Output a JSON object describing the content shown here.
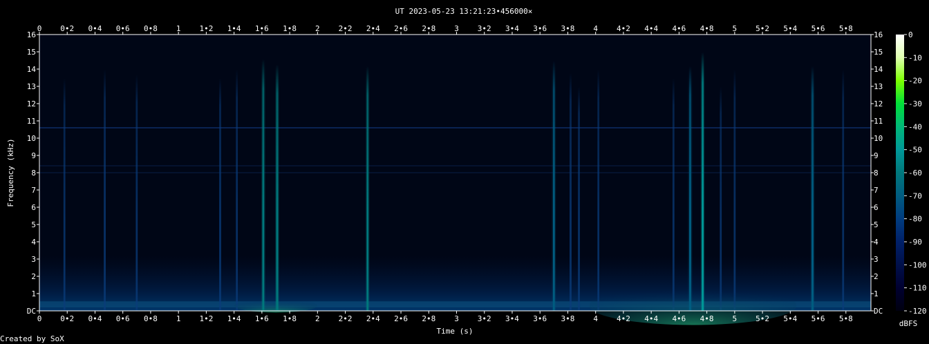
{
  "chart_data": {
    "type": "heatmap",
    "title": "UT 2023-05-23 13:21:23•456000×",
    "xlabel": "Time (s)",
    "ylabel": "Frequency (kHz)",
    "colorbar_label": "dBFS",
    "footer": "Created by SoX",
    "xlim": [
      0,
      5.98
    ],
    "ylim": [
      0,
      16
    ],
    "x_tick_values": [
      0,
      0.2,
      0.4,
      0.6,
      0.8,
      1,
      1.2,
      1.4,
      1.6,
      1.8,
      2,
      2.2,
      2.4,
      2.6,
      2.8,
      3,
      3.2,
      3.4,
      3.6,
      3.8,
      4,
      4.2,
      4.4,
      4.6,
      4.8,
      5,
      5.2,
      5.4,
      5.6,
      5.8
    ],
    "x_tick_labels": [
      "0",
      "0•2",
      "0•4",
      "0•6",
      "0•8",
      "1",
      "1•2",
      "1•4",
      "1•6",
      "1•8",
      "2",
      "2•2",
      "2•4",
      "2•6",
      "2•8",
      "3",
      "3•2",
      "3•4",
      "3•6",
      "3•8",
      "4",
      "4•2",
      "4•4",
      "4•6",
      "4•8",
      "5",
      "5•2",
      "5•4",
      "5•6",
      "5•8"
    ],
    "y_tick_values": [
      0,
      1,
      2,
      3,
      4,
      5,
      6,
      7,
      8,
      9,
      10,
      11,
      12,
      13,
      14,
      15,
      16
    ],
    "y_tick_labels": [
      "DC",
      "1",
      "2",
      "3",
      "4",
      "5",
      "6",
      "7",
      "8",
      "9",
      "10",
      "11",
      "12",
      "13",
      "14",
      "15",
      "16"
    ],
    "colorbar_ticks": [
      "0",
      "-10",
      "-20",
      "-30",
      "-40",
      "-50",
      "-60",
      "-70",
      "-80",
      "-90",
      "-100",
      "-110",
      "-120"
    ],
    "colorbar_range": [
      -120,
      0
    ],
    "colormap": [
      "#ffffff",
      "#e0ffb0",
      "#7cff00",
      "#00e038",
      "#00b878",
      "#009898",
      "#00787c",
      "#005c80",
      "#003c80",
      "#002068",
      "#00104a",
      "#000030",
      "#000010"
    ],
    "background_level_dbfs": -115,
    "low_band_noise_top_khz": 3.2,
    "horizontal_lines_khz": [
      10.6,
      8.4,
      8.0
    ],
    "strong_events": [
      {
        "t": 1.61,
        "top_khz": 14.6,
        "peak_dbfs": -55
      },
      {
        "t": 1.71,
        "top_khz": 14.3,
        "peak_dbfs": -60
      },
      {
        "t": 2.36,
        "top_khz": 14.2,
        "peak_dbfs": -55
      },
      {
        "t": 3.7,
        "top_khz": 14.5,
        "peak_dbfs": -72
      },
      {
        "t": 4.68,
        "top_khz": 14.2,
        "peak_dbfs": -70
      },
      {
        "t": 4.77,
        "top_khz": 15.0,
        "peak_dbfs": -48
      },
      {
        "t": 5.56,
        "top_khz": 14.2,
        "peak_dbfs": -65
      }
    ],
    "weak_events": [
      {
        "t": 0.18,
        "top_khz": 13.5
      },
      {
        "t": 0.47,
        "top_khz": 14.0
      },
      {
        "t": 0.7,
        "top_khz": 13.7
      },
      {
        "t": 1.3,
        "top_khz": 13.5
      },
      {
        "t": 1.42,
        "top_khz": 14.0
      },
      {
        "t": 3.82,
        "top_khz": 13.8
      },
      {
        "t": 3.88,
        "top_khz": 13.0
      },
      {
        "t": 4.02,
        "top_khz": 14.0
      },
      {
        "t": 4.56,
        "top_khz": 13.5
      },
      {
        "t": 4.9,
        "top_khz": 13.0
      },
      {
        "t": 5.0,
        "top_khz": 14.0
      },
      {
        "t": 5.78,
        "top_khz": 14.0
      }
    ]
  }
}
